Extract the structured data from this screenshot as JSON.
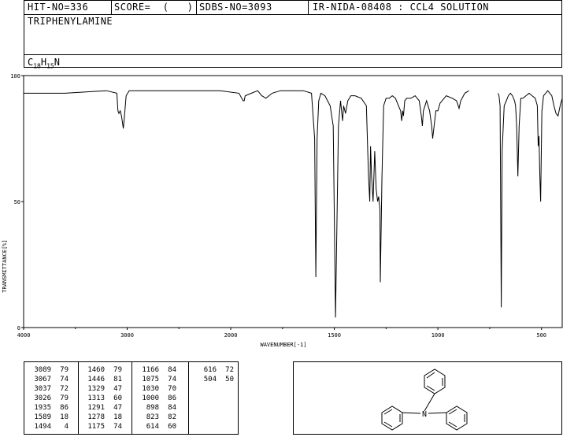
{
  "header": {
    "hit_no": "HIT-NO=336",
    "score": "SCORE=  (   )",
    "sdbs_no": "SDBS-NO=3093",
    "ir_info": "IR-NIDA-08408 : CCL4 SOLUTION",
    "compound_name": "TRIPHENYLAMINE",
    "formula": {
      "c": "C",
      "c_sub": "18",
      "h": "H",
      "h_sub": "15",
      "n": "N"
    }
  },
  "chart_data": {
    "type": "line",
    "xlabel": "WAVENUMBER[-1]",
    "ylabel": "TRANSMITTANCE[%]",
    "xlim": [
      4000,
      400
    ],
    "ylim": [
      0,
      100
    ],
    "x_ticks": [
      "4000",
      "3000",
      "2000",
      "1500",
      "1000",
      "500"
    ],
    "y_ticks": [
      "100",
      "50",
      "0"
    ],
    "series": [
      {
        "x": [
          4000,
          3600,
          3200,
          3100,
          3089,
          3080,
          3067,
          3055,
          3037,
          3026,
          3010,
          2980,
          2700,
          2400,
          2100,
          1960,
          1940,
          1935,
          1930,
          1900,
          1870,
          1850,
          1830,
          1800,
          1760,
          1700,
          1650,
          1610,
          1595,
          1589,
          1583,
          1575,
          1565,
          1545,
          1520,
          1505,
          1494,
          1480,
          1470,
          1460,
          1455,
          1446,
          1435,
          1420,
          1400,
          1370,
          1345,
          1335,
          1329,
          1325,
          1320,
          1313,
          1305,
          1298,
          1291,
          1286,
          1280,
          1278,
          1270,
          1262,
          1250,
          1235,
          1220,
          1205,
          1190,
          1180,
          1175,
          1170,
          1166,
          1160,
          1150,
          1130,
          1110,
          1090,
          1080,
          1075,
          1070,
          1055,
          1040,
          1030,
          1025,
          1010,
          1000,
          990,
          960,
          930,
          910,
          898,
          890,
          870,
          850
        ],
        "y": [
          93,
          93,
          94,
          93,
          86,
          85,
          86,
          84,
          79,
          84,
          92,
          94,
          94,
          94,
          94,
          93,
          90,
          90,
          92,
          93,
          94,
          92,
          91,
          93,
          94,
          94,
          94,
          93,
          75,
          20,
          75,
          90,
          93,
          92,
          88,
          80,
          4,
          80,
          90,
          82,
          88,
          85,
          90,
          92,
          92,
          91,
          88,
          60,
          50,
          72,
          60,
          50,
          70,
          55,
          50,
          52,
          47,
          18,
          60,
          88,
          91,
          91,
          92,
          91,
          88,
          86,
          82,
          86,
          84,
          90,
          91,
          91,
          92,
          90,
          84,
          80,
          86,
          90,
          86,
          80,
          75,
          86,
          86,
          89,
          92,
          91,
          90,
          87,
          90,
          93,
          94
        ]
      },
      {
        "x": [
          710,
          705,
          700,
          694,
          690,
          680,
          670,
          660,
          650,
          640,
          630,
          625,
          620,
          614,
          608,
          600,
          590,
          575,
          560,
          545,
          530,
          520,
          516,
          512,
          508,
          504,
          498,
          490,
          480,
          470,
          460,
          450,
          440,
          430,
          420,
          410,
          400
        ],
        "y": [
          93,
          92,
          88,
          8,
          70,
          88,
          90,
          92,
          93,
          92,
          90,
          88,
          80,
          60,
          80,
          91,
          91,
          92,
          93,
          92,
          91,
          88,
          72,
          76,
          60,
          50,
          86,
          92,
          93,
          94,
          93,
          92,
          88,
          85,
          84,
          88,
          91
        ]
      }
    ]
  },
  "peak_table": [
    [
      "3089",
      "79"
    ],
    [
      "3067",
      "74"
    ],
    [
      "3037",
      "72"
    ],
    [
      "3026",
      "79"
    ],
    [
      "1935",
      "86"
    ],
    [
      "1589",
      "18"
    ],
    [
      "1494",
      "4"
    ],
    [
      "1460",
      "79"
    ],
    [
      "1446",
      "81"
    ],
    [
      "1329",
      "47"
    ],
    [
      "1313",
      "60"
    ],
    [
      "1291",
      "47"
    ],
    [
      "1278",
      "18"
    ],
    [
      "1175",
      "74"
    ],
    [
      "1166",
      "84"
    ],
    [
      "1075",
      "74"
    ],
    [
      "1030",
      "70"
    ],
    [
      "1000",
      "86"
    ],
    [
      "898",
      "84"
    ],
    [
      "823",
      "82"
    ],
    [
      "614",
      "60"
    ],
    [
      "616",
      "72"
    ],
    [
      "504",
      "50"
    ]
  ],
  "structure": {
    "center_atom": "N"
  }
}
